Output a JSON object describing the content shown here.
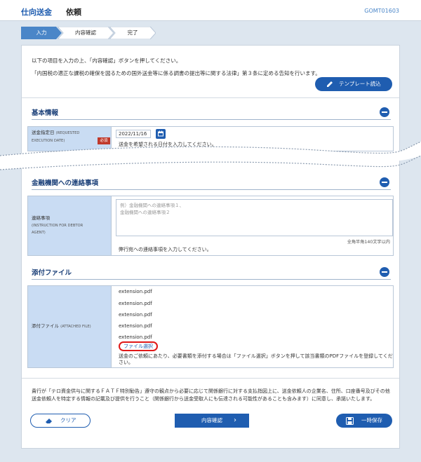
{
  "header": {
    "title": "仕向送金",
    "subtitle": "依頼",
    "screen_id": "GOMT01603"
  },
  "steps": [
    {
      "label": "入力",
      "state": "active"
    },
    {
      "label": "内容確認",
      "state": "inactive"
    },
    {
      "label": "完了",
      "state": "inactive"
    }
  ],
  "intro": {
    "line1": "以下の項目を入力の上、「内容確認」ボタンを押してください。",
    "line2": "「内国税の適正な課税の確保を図るための国外送金等に係る調書の提出等に関する法律」第３条に定める告知を行います。"
  },
  "template_button": "テンプレート読込",
  "basic": {
    "title": "基本情報",
    "date_label": "送金指定日",
    "date_label_en": "(REQUESTED",
    "date_label_en2": "EXECUTION DATE)",
    "required": "必須",
    "date_value": "2022/11/16",
    "date_help": "送金を希望される日付を入力してください。"
  },
  "bank_contact": {
    "title": "金融機関への連絡事項",
    "label": "連絡事項",
    "label_en": "(INSTRUCTION FOR DEBTOR",
    "label_en2": "AGENT)",
    "placeholder_line1": "例）金融機関への連絡事項１、",
    "placeholder_line2": "金融機関への連絡事項２",
    "counter": "全角半角140文字以内",
    "help": "弊行宛への連絡事項を入力してください。"
  },
  "attachments": {
    "title": "添付ファイル",
    "label": "添付ファイル",
    "label_en": "(ATTACHED FILE)",
    "files": [
      "extension.pdf",
      "extension.pdf",
      "extension.pdf",
      "extension.pdf",
      "extension.pdf"
    ],
    "select_button": "ファイル選択",
    "help_line1": "送金のご依頼にあたり、必要書類を添付する場合は「ファイル選択」ボタンを押して該当書類のPDFファイルを登録してくだ",
    "help_line2": "さい。"
  },
  "notice": "貴行が「テロ資金供与に関するＦＡＴＦ特別勧告」遵守の観点から必要に応じて関係銀行に対する支払指図上に、送金依頼人の企業名、住所、口座番号及びその他送金依頼人を特定する情報の記載及び提供を行うこと（関係銀行から送金受取人にも伝達される可能性があることも含みます）に同意し、承諾いたします。",
  "buttons": {
    "clear": "クリア",
    "confirm": "内容確認",
    "save": "一時保存"
  },
  "colors": {
    "primary": "#1f5db0",
    "label_bg": "#c9dcf3",
    "required": "#c0392b",
    "highlight": "#e01818"
  }
}
